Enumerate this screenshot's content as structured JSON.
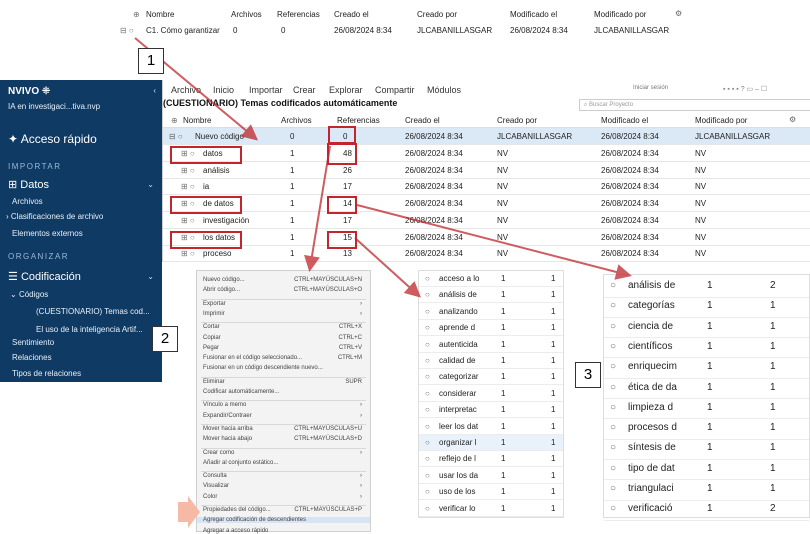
{
  "topstrip": {
    "headers": [
      "Nombre",
      "Archivos",
      "Referencias",
      "Creado el",
      "Creado por",
      "Modificado el",
      "Modificado por"
    ],
    "row": [
      "C1. Cómo garantizar",
      "0",
      "0",
      "26/08/2024 8:34",
      "JLCABANILLASGAR",
      "26/08/2024 8:34",
      "JLCABANILLASGAR"
    ]
  },
  "sidebar": {
    "app": "NVIVO",
    "project": "IA en investigaci...tiva.nvp",
    "quick": "Acceso rápido",
    "sec_importar": "IMPORTAR",
    "datos": "Datos",
    "archivos": "Archivos",
    "clasif": "Clasificaciones de archivo",
    "externos": "Elementos externos",
    "sec_organizar": "ORGANIZAR",
    "codificacion": "Codificación",
    "codigos": "Códigos",
    "item1": "(CUESTIONARIO) Temas cod...",
    "item2": "El uso de la inteligencia Artif...",
    "sentimiento": "Sentimiento",
    "relaciones": "Relaciones",
    "tipos": "Tipos de relaciones"
  },
  "menu": [
    "Archivo",
    "Inicio",
    "Importar",
    "Crear",
    "Explorar",
    "Compartir",
    "Módulos"
  ],
  "signin": "Iniciar sesión",
  "title": "(CUESTIONARIO) Temas codificados automáticamente",
  "search_placeholder": "Buscar Proyecto",
  "table": {
    "headers": [
      "Nombre",
      "Archivos",
      "Referencias",
      "Creado el",
      "Creado por",
      "Modificado el",
      "Modificado por"
    ],
    "parent": [
      "Nuevo código",
      "0",
      "0",
      "26/08/2024 8:34",
      "JLCABANILLASGAR",
      "26/08/2024 8:34",
      "JLCABANILLASGAR"
    ],
    "rows": [
      [
        "datos",
        "1",
        "48",
        "26/08/2024 8:34",
        "NV",
        "26/08/2024 8:34",
        "NV"
      ],
      [
        "análisis",
        "1",
        "26",
        "26/08/2024 8:34",
        "NV",
        "26/08/2024 8:34",
        "NV"
      ],
      [
        "ia",
        "1",
        "17",
        "26/08/2024 8:34",
        "NV",
        "26/08/2024 8:34",
        "NV"
      ],
      [
        "de datos",
        "1",
        "14",
        "26/08/2024 8:34",
        "NV",
        "26/08/2024 8:34",
        "NV"
      ],
      [
        "investigación",
        "1",
        "17",
        "26/08/2024 8:34",
        "NV",
        "26/08/2024 8:34",
        "NV"
      ],
      [
        "los datos",
        "1",
        "15",
        "26/08/2024 8:34",
        "NV",
        "26/08/2024 8:34",
        "NV"
      ],
      [
        "proceso",
        "1",
        "13",
        "26/08/2024 8:34",
        "NV",
        "26/08/2024 8:34",
        "NV"
      ]
    ]
  },
  "context_menu": [
    {
      "label": "Nuevo código...",
      "shortcut": "CTRL+MAYÚSCULAS+N"
    },
    {
      "label": "Abrir código...",
      "shortcut": "CTRL+MAYÚSCULAS+O"
    },
    {
      "label": "Exportar",
      "shortcut": "›"
    },
    {
      "label": "Imprimir",
      "shortcut": "›"
    },
    {
      "label": "Cortar",
      "shortcut": "CTRL+X"
    },
    {
      "label": "Copiar",
      "shortcut": "CTRL+C"
    },
    {
      "label": "Pegar",
      "shortcut": "CTRL+V"
    },
    {
      "label": "Fusionar en el código seleccionado...",
      "shortcut": "CTRL+M"
    },
    {
      "label": "Fusionar en un código descendiente nuevo...",
      "shortcut": ""
    },
    {
      "label": "Eliminar",
      "shortcut": "SUPR"
    },
    {
      "label": "Codificar automáticamente...",
      "shortcut": ""
    },
    {
      "label": "Vínculo a memo",
      "shortcut": "›"
    },
    {
      "label": "Expandir/Contraer",
      "shortcut": "›"
    },
    {
      "label": "Mover hacia arriba",
      "shortcut": "CTRL+MAYÚSCULAS+U"
    },
    {
      "label": "Mover hacia abajo",
      "shortcut": "CTRL+MAYÚSCULAS+D"
    },
    {
      "label": "Crear como",
      "shortcut": "›"
    },
    {
      "label": "Añadir al conjunto estático...",
      "shortcut": ""
    },
    {
      "label": "Consulta",
      "shortcut": "›"
    },
    {
      "label": "Visualizar",
      "shortcut": "›"
    },
    {
      "label": "Color",
      "shortcut": "›"
    },
    {
      "label": "Propiedades del código...",
      "shortcut": "CTRL+MAYÚSCULAS+P"
    },
    {
      "label": "Agregar codificación de descendientes",
      "shortcut": ""
    },
    {
      "label": "Agregar a acceso rápido",
      "shortcut": ""
    }
  ],
  "panel2": [
    [
      "acceso a lo",
      "1",
      "1"
    ],
    [
      "análisis de",
      "1",
      "1"
    ],
    [
      "analizando",
      "1",
      "1"
    ],
    [
      "aprende d",
      "1",
      "1"
    ],
    [
      "autenticida",
      "1",
      "1"
    ],
    [
      "calidad de",
      "1",
      "1"
    ],
    [
      "categorizar",
      "1",
      "1"
    ],
    [
      "considerar",
      "1",
      "1"
    ],
    [
      "interpretac",
      "1",
      "1"
    ],
    [
      "leer los dat",
      "1",
      "1"
    ],
    [
      "organizar l",
      "1",
      "1"
    ],
    [
      "reflejo de l",
      "1",
      "1"
    ],
    [
      "usar los da",
      "1",
      "1"
    ],
    [
      "uso de los",
      "1",
      "1"
    ],
    [
      "verificar lo",
      "1",
      "1"
    ]
  ],
  "panel3": [
    [
      "análisis de",
      "1",
      "2"
    ],
    [
      "categorías",
      "1",
      "1"
    ],
    [
      "ciencia de",
      "1",
      "1"
    ],
    [
      "científicos",
      "1",
      "1"
    ],
    [
      "enriquecim",
      "1",
      "1"
    ],
    [
      "ética de da",
      "1",
      "1"
    ],
    [
      "limpieza d",
      "1",
      "1"
    ],
    [
      "procesos d",
      "1",
      "1"
    ],
    [
      "síntesis de",
      "1",
      "1"
    ],
    [
      "tipo de dat",
      "1",
      "1"
    ],
    [
      "triangulaci",
      "1",
      "1"
    ],
    [
      "verificació",
      "1",
      "2"
    ]
  ],
  "callouts": [
    "1",
    "2",
    "3"
  ]
}
